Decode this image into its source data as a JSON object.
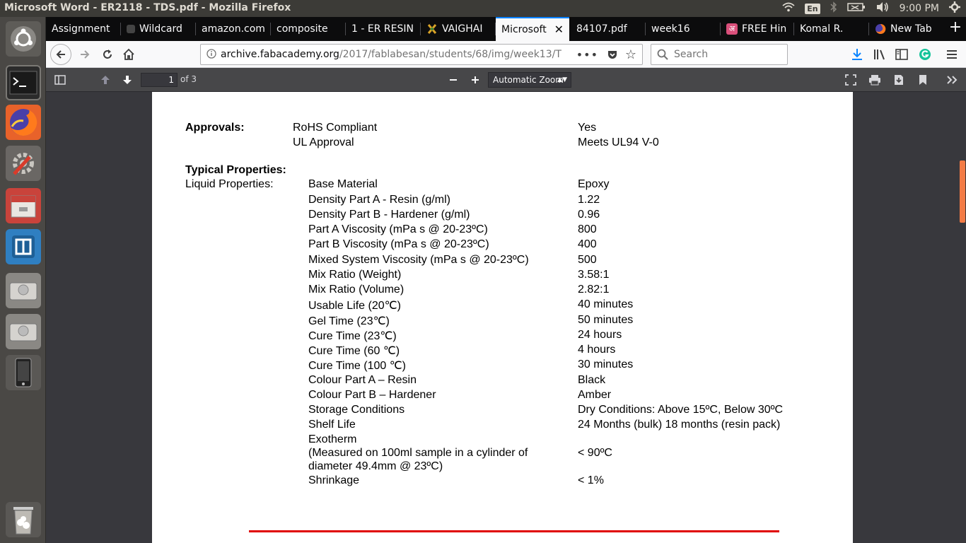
{
  "window_title": "Microsoft Word - ER2118 - TDS.pdf - Mozilla Firefox",
  "tray": {
    "keyboard": "En",
    "time": "9:00 PM"
  },
  "tabs": [
    {
      "label": "Assignment",
      "color": "#2b2a33"
    },
    {
      "label": "Wildcard",
      "color": "#5a5a5a"
    },
    {
      "label": "amazon.com",
      "color": ""
    },
    {
      "label": "composite",
      "color": ""
    },
    {
      "label": "1 - ER RESIN",
      "color": ""
    },
    {
      "label": "VAIGHAI",
      "color": "#3a8a3a"
    },
    {
      "label": "Microsoft",
      "color": ""
    },
    {
      "label": "84107.pdf",
      "color": ""
    },
    {
      "label": "week16",
      "color": ""
    },
    {
      "label": "FREE Hin",
      "color": "#d94f7a"
    },
    {
      "label": "Komal R.",
      "color": ""
    },
    {
      "label": "New Tab",
      "color": "#e66000"
    }
  ],
  "nav": {
    "url_domain": "archive.fabacademy.org",
    "url_path": "/2017/fablabesan/students/68/img/week13/T",
    "search_placeholder": "Search"
  },
  "pdf": {
    "page_current": "1",
    "page_of": "of 3",
    "zoom": "Automatic Zoom"
  },
  "document": {
    "approvals_heading": "Approvals:",
    "approvals": [
      {
        "name": "RoHS Compliant",
        "value": "Yes"
      },
      {
        "name": "UL Approval",
        "value": "Meets UL94 V-0"
      }
    ],
    "typical_heading": "Typical Properties:",
    "liquid_heading": "Liquid Properties:",
    "properties": [
      {
        "name": "Base Material",
        "value": "Epoxy"
      },
      {
        "name": "Density Part A - Resin (g/ml)",
        "value": "1.22"
      },
      {
        "name": "Density Part B - Hardener (g/ml)",
        "value": "0.96"
      },
      {
        "name": "Part A Viscosity (mPa s @ 20-23ºC)",
        "value": "800"
      },
      {
        "name": "Part B Viscosity (mPa s @ 20-23ºC)",
        "value": "400"
      },
      {
        "name": "Mixed System Viscosity (mPa s @ 20-23ºC)",
        "value": "500"
      },
      {
        "name": "Mix Ratio (Weight)",
        "value": "3.58:1"
      },
      {
        "name": "Mix Ratio (Volume)",
        "value": "2.82:1"
      },
      {
        "name": "Usable Life (20℃)",
        "value": "40 minutes"
      },
      {
        "name": "Gel Time (23℃)",
        "value": "50 minutes"
      },
      {
        "name": "Cure Time (23℃)",
        "value": "24 hours"
      },
      {
        "name": "Cure Time (60 ℃)",
        "value": "4 hours"
      },
      {
        "name": "Cure Time (100 ℃)",
        "value": "30 minutes"
      },
      {
        "name": "Colour Part A – Resin",
        "value": "Black"
      },
      {
        "name": "Colour Part B – Hardener",
        "value": "Amber"
      },
      {
        "name": "Storage Conditions",
        "value": "Dry Conditions: Above 15ºC, Below 30ºC"
      },
      {
        "name": "Shelf Life",
        "value": "24 Months (bulk) 18 months (resin pack)"
      }
    ],
    "exotherm": {
      "name": "Exotherm",
      "note_line1": "(Measured on 100ml sample in a cylinder of",
      "note_line2": "diameter 49.4mm @ 23ºC)",
      "value": "< 90ºC"
    },
    "shrinkage": {
      "name": "Shrinkage",
      "value": "< 1%"
    }
  }
}
